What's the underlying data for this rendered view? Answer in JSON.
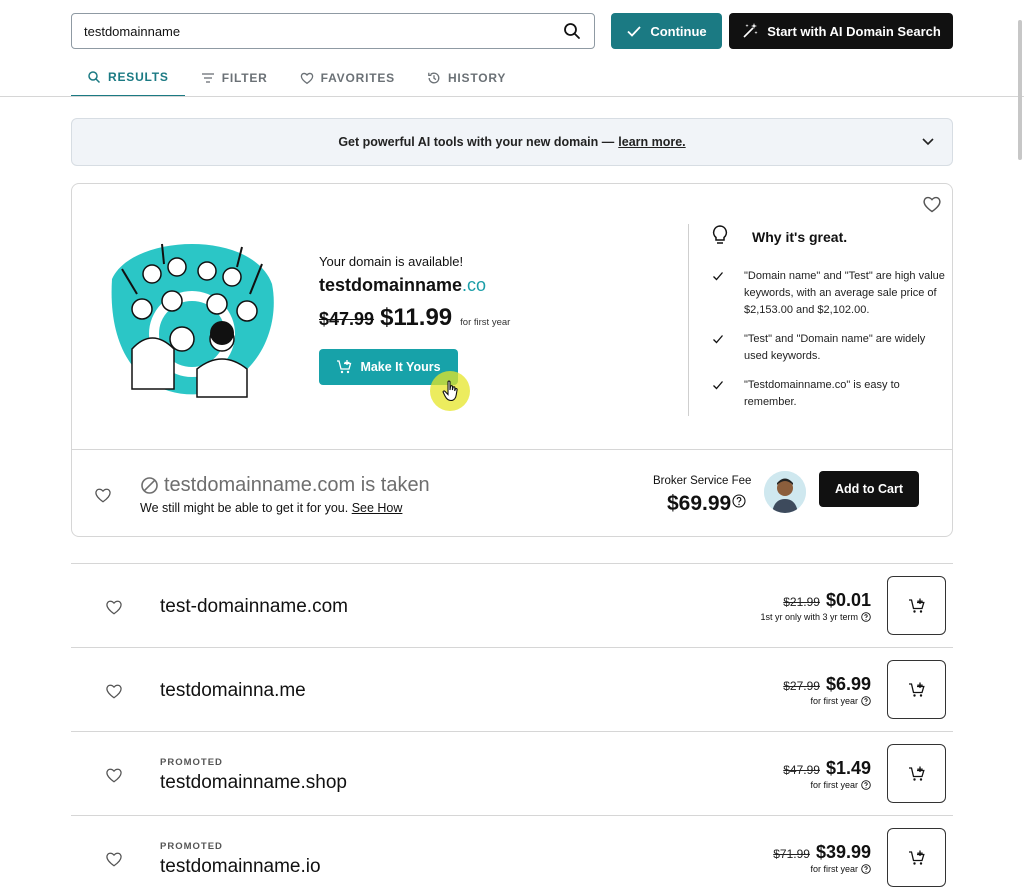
{
  "search": {
    "value": "testdomainname",
    "continue_label": "Continue",
    "ai_label": "Start with AI Domain Search"
  },
  "tabs": [
    {
      "label": "RESULTS",
      "icon": "search-icon",
      "active": true
    },
    {
      "label": "FILTER",
      "icon": "filter-icon",
      "active": false
    },
    {
      "label": "FAVORITES",
      "icon": "heart-icon",
      "active": false
    },
    {
      "label": "HISTORY",
      "icon": "history-icon",
      "active": false
    }
  ],
  "banner": {
    "text": "Get powerful AI tools with your new domain —",
    "link": "learn more."
  },
  "featured": {
    "available_text": "Your domain is available!",
    "name": "testdomainname",
    "tld": ".co",
    "old_price": "$47.99",
    "new_price": "$11.99",
    "price_note": "for first year",
    "button_label": "Make It Yours",
    "why_title": "Why it's great.",
    "why_items": [
      "\"Domain name\" and \"Test\" are high value keywords, with an average sale price of $2,153.00 and $2,102.00.",
      "\"Test\" and \"Domain name\" are widely used keywords.",
      "\"Testdomainname.co\" is easy to remember."
    ]
  },
  "taken": {
    "title": "testdomainname.com is taken",
    "subtitle": "We still might be able to get it for you.",
    "link": "See How",
    "broker_label": "Broker Service Fee",
    "broker_price": "$69.99",
    "button_label": "Add to Cart"
  },
  "results": [
    {
      "promoted": "",
      "name": "test-domainname.com",
      "old": "$21.99",
      "new": "$0.01",
      "term": "1st yr only with 3 yr term"
    },
    {
      "promoted": "",
      "name": "testdomainna.me",
      "old": "$27.99",
      "new": "$6.99",
      "term": "for first year"
    },
    {
      "promoted": "PROMOTED",
      "name": "testdomainname.shop",
      "old": "$47.99",
      "new": "$1.49",
      "term": "for first year"
    },
    {
      "promoted": "PROMOTED",
      "name": "testdomainname.io",
      "old": "$71.99",
      "new": "$39.99",
      "term": "for first year"
    }
  ],
  "colors": {
    "accent": "#1b7a83",
    "accent_light": "#17a2a9",
    "tld": "#1b9ea8",
    "dark": "#111111"
  }
}
